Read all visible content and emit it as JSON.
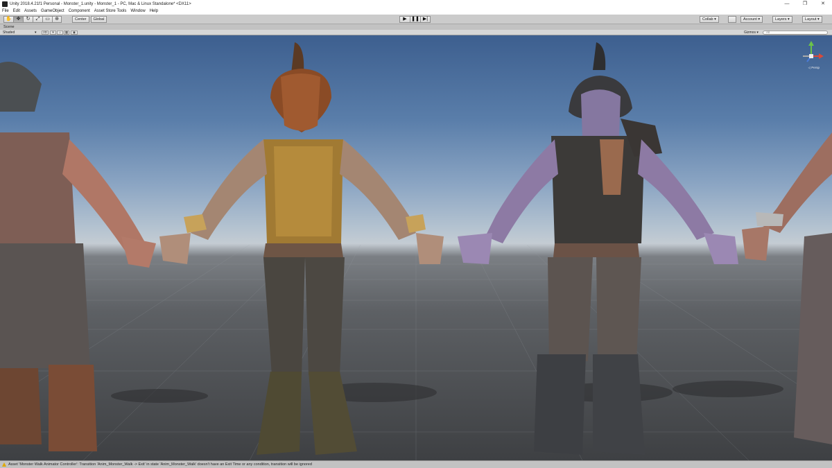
{
  "window": {
    "title": "Unity 2018.4.21f1 Personal - Monster_1.unity - Monster_1 - PC, Mac & Linux Standalone* <DX11>",
    "minimize": "—",
    "maximize": "❐",
    "close": "✕"
  },
  "menu": [
    "File",
    "Edit",
    "Assets",
    "GameObject",
    "Component",
    "Asset Store Tools",
    "Window",
    "Help"
  ],
  "toolbar": {
    "pivot": "Center",
    "space": "Global",
    "collab": "Collab ▾",
    "account": "Account ▾",
    "layers": "Layers ▾",
    "layout": "Layout ▾"
  },
  "scene": {
    "tab_label": "Scene",
    "draw_mode": "Shaded",
    "mode_2d": "2D",
    "gizmos": "Gizmos ▾",
    "search_placeholder": "All",
    "gizmo_label": "◁ Persp"
  },
  "status": {
    "message": "Asset 'Monster Walk Animator Controller': Transition 'Anim_Monster_Walk -> Exit' in state 'Anim_Monster_Walk' doesn't have an Exit Time or any condition, transition will be ignored"
  },
  "colors": {
    "sky_top": "#3d5f8f",
    "horizon": "#c4ccd3",
    "ground": "#5d6064",
    "warning": "#e0a800"
  }
}
